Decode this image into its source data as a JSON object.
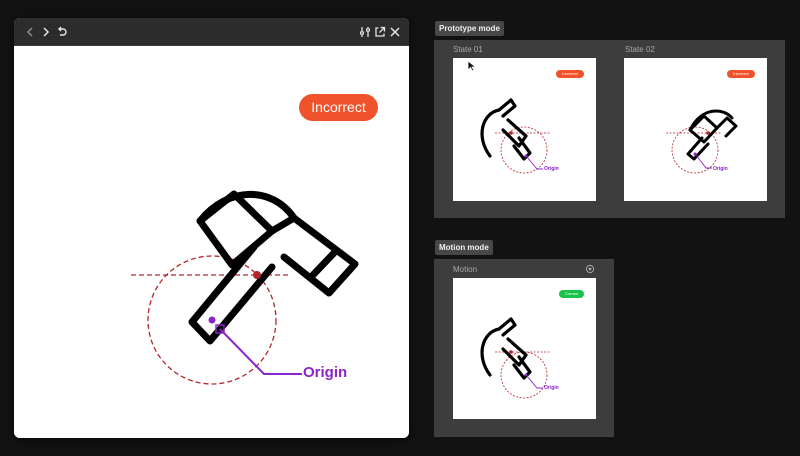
{
  "preview": {
    "badge": "Incorrect",
    "origin_label": "Origin"
  },
  "prototype": {
    "tag": "Prototype mode",
    "states": [
      {
        "label": "State 01",
        "badge": "Incorrect",
        "origin_label": "Origin"
      },
      {
        "label": "State 02",
        "badge": "Incorrect",
        "origin_label": "Origin"
      }
    ]
  },
  "motion": {
    "tag": "Motion mode",
    "label": "Motion",
    "badge": "Correct",
    "origin_label": "Origin"
  },
  "colors": {
    "incorrect": "#f0532b",
    "correct": "#19c24a",
    "origin": "#8a24cc",
    "guide": "#b3262b"
  },
  "icons": [
    "chevron-left-icon",
    "chevron-right-icon",
    "undo-icon",
    "adjust-icon",
    "open-external-icon",
    "close-icon",
    "target-icon",
    "hammer-icon",
    "cursor-icon"
  ]
}
